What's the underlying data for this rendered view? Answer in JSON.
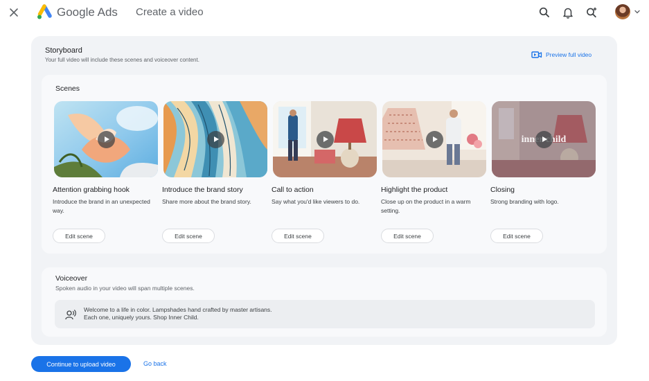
{
  "header": {
    "brand_google": "Google",
    "brand_ads": "Ads",
    "page_title": "Create a video",
    "icons": [
      "close-icon",
      "google-ads-logo",
      "search-icon",
      "notifications-icon",
      "sparkle-search-icon",
      "avatar",
      "chevron-down-icon"
    ]
  },
  "storyboard": {
    "title": "Storyboard",
    "subtitle": "Your full video will include these scenes and voiceover content.",
    "preview_label": "Preview full video"
  },
  "scenes": {
    "title": "Scenes",
    "items": [
      {
        "name": "Attention grabbing hook",
        "description": "Introduce the brand in an unexpected way.",
        "edit_label": "Edit scene"
      },
      {
        "name": "Introduce the brand story",
        "description": "Share more about the brand story.",
        "edit_label": "Edit scene"
      },
      {
        "name": "Call to action",
        "description": "Say what you'd like viewers to do.",
        "edit_label": "Edit scene"
      },
      {
        "name": "Highlight the product",
        "description": "Close up on the product in a warm setting.",
        "edit_label": "Edit scene"
      },
      {
        "name": "Closing",
        "description": "Strong branding with logo.",
        "edit_label": "Edit scene",
        "thumbnail_overlay_text": "inner child"
      }
    ]
  },
  "voiceover": {
    "title": "Voiceover",
    "subtitle": "Spoken audio in your video will span multiple scenes.",
    "line1": "Welcome to a life in color. Lampshades hand crafted by master artisans.",
    "line2": "Each one, uniquely yours. Shop Inner Child."
  },
  "actions": {
    "continue_label": "Continue to upload video",
    "back_label": "Go back"
  },
  "colors": {
    "accent": "#1a73e8",
    "panel": "#f1f3f6",
    "card": "#f8f9fb"
  }
}
